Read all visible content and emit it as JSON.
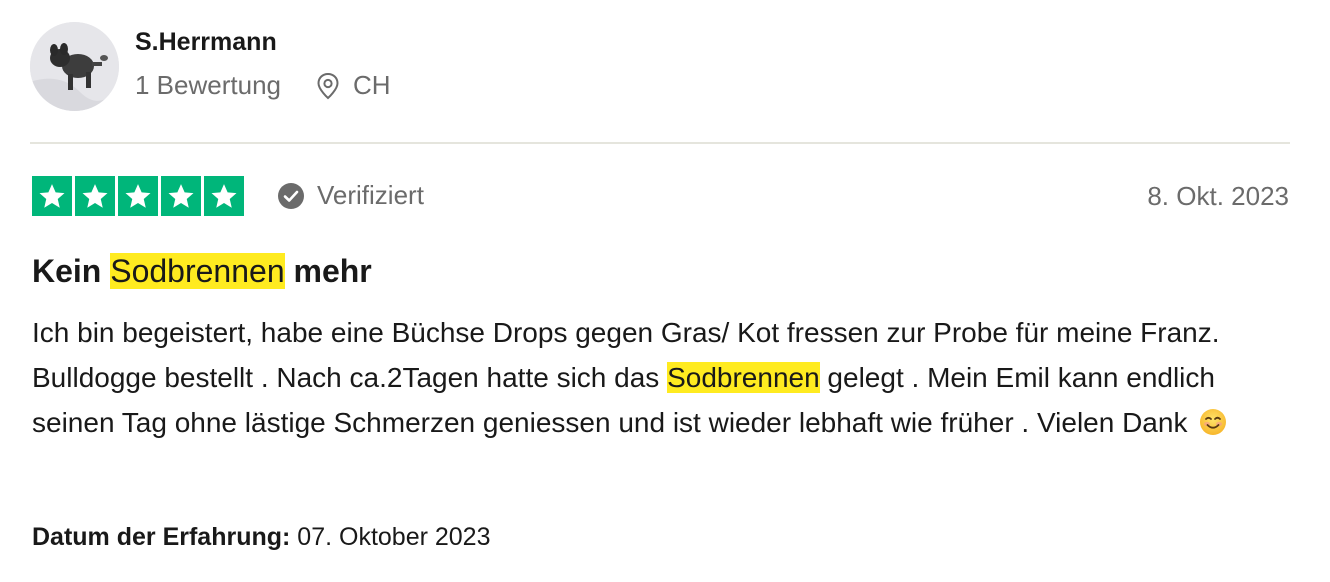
{
  "reviewer": {
    "name": "S.Herrmann",
    "review_count": "1 Bewertung",
    "country": "CH",
    "avatar_icon": "dog-avatar-photo",
    "location_icon": "location-pin-icon"
  },
  "review": {
    "rating": 5,
    "max_rating": 5,
    "star_color": "#00b67a",
    "verified_label": "Verifiziert",
    "verified_icon": "check-circle-icon",
    "date": "8. Okt. 2023",
    "title_prefix": "Kein ",
    "title_highlight": "Sodbrennen",
    "title_suffix": " mehr",
    "highlight_color": "#ffeb20",
    "body_part1": "Ich bin begeistert, habe eine Büchse Drops gegen Gras/ Kot fressen zur Probe für meine Franz. Bulldogge bestellt . Nach ca.2Tagen hatte sich das ",
    "body_highlight": "Sodbrennen",
    "body_part2": " gelegt . Mein Emil kann endlich seinen Tag ohne lästige Schmerzen geniessen und ist wieder lebhaft wie früher . Vielen Dank",
    "emoji_icon": "smiling-face-emoji-icon",
    "experience_label": "Datum der Erfahrung:",
    "experience_date": " 07. Oktober 2023"
  }
}
